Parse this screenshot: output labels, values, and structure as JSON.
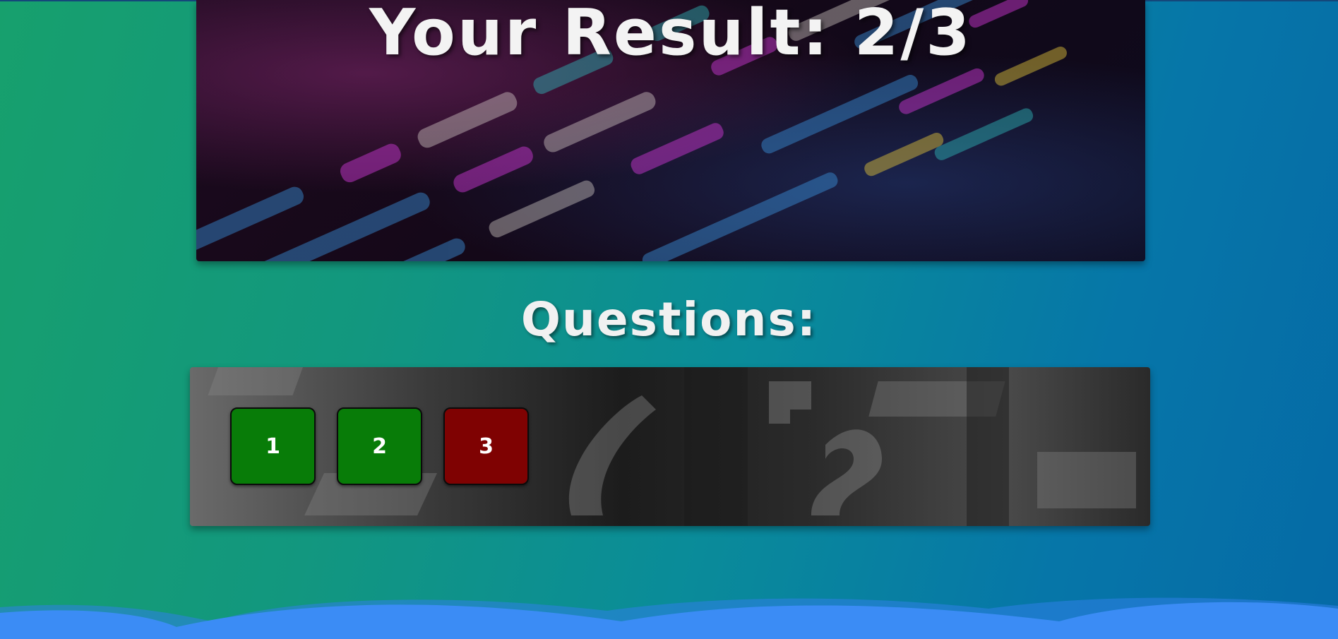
{
  "result": {
    "title": "Your Result: 2/3"
  },
  "questions": {
    "heading": "Questions:",
    "items": [
      {
        "label": "1",
        "status": "correct",
        "color": "#087c08"
      },
      {
        "label": "2",
        "status": "correct",
        "color": "#087c08"
      },
      {
        "label": "3",
        "status": "incorrect",
        "color": "#7f0202"
      }
    ]
  },
  "theme": {
    "background_start": "#17a06d",
    "background_end": "#056aa6",
    "wave_color": "#3b8cf5",
    "correct_color": "#087c08",
    "incorrect_color": "#7f0202"
  }
}
